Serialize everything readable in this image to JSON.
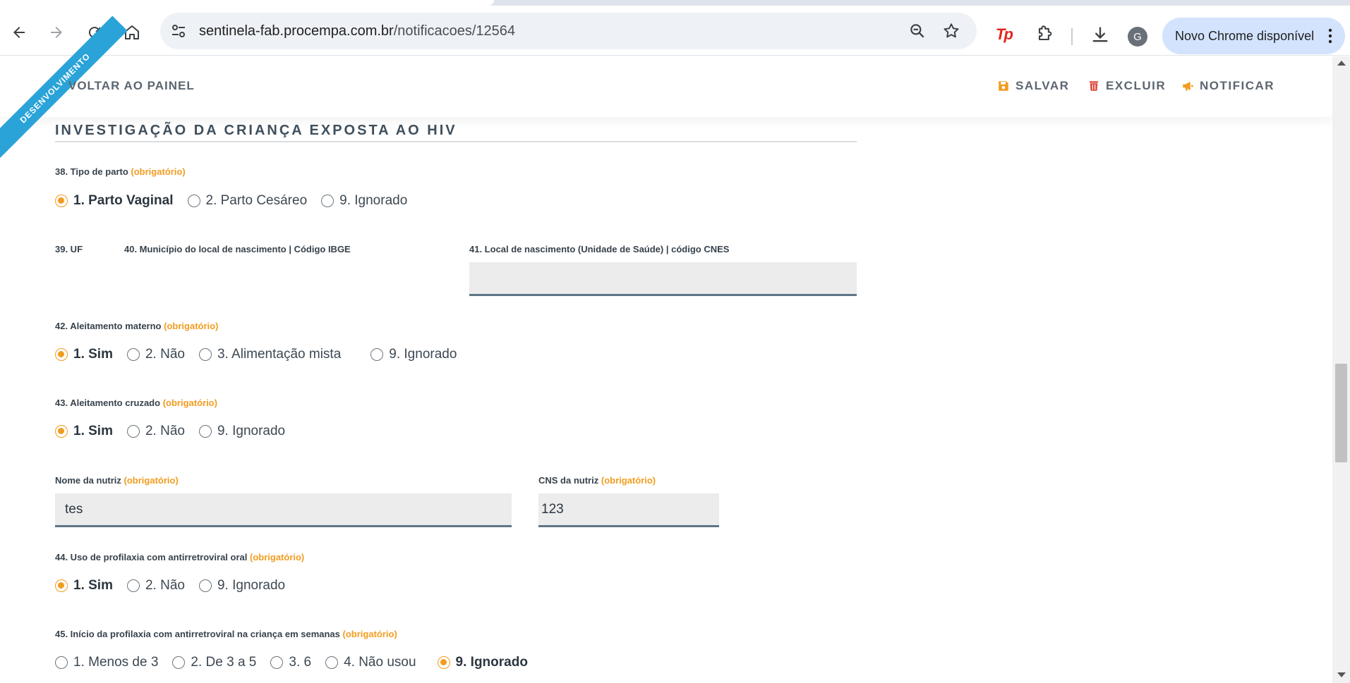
{
  "browser": {
    "url_host": "sentinela-fab.procempa.com.br",
    "url_path": "/notificacoes/12564",
    "ext_tp_label": "Tp",
    "avatar_letter": "G",
    "update_label": "Novo Chrome disponível"
  },
  "header": {
    "ribbon": "DESENVOLVIMENTO",
    "back_label": "VOLTAR AO PAINEL",
    "save_label": "SALVAR",
    "delete_label": "EXCLUIR",
    "notify_label": "NOTIFICAR"
  },
  "colors": {
    "accent": "#f29c1f",
    "delete": "#e0453a",
    "save": "#f29c1f",
    "notify": "#f29c1f",
    "ribbon": "#2aa3d8"
  },
  "form": {
    "section_title": "INVESTIGAÇÃO DA CRIANÇA EXPOSTA AO HIV",
    "required_tag": "(obrigatório)",
    "q38": {
      "label": "38. Tipo de parto",
      "options": [
        "1. Parto Vaginal",
        "2. Parto Cesáreo",
        "9. Ignorado"
      ],
      "selected": "1. Parto Vaginal"
    },
    "q39": {
      "label": "39. UF"
    },
    "q40": {
      "label": "40. Município do local de nascimento | Código IBGE"
    },
    "q41": {
      "label": "41. Local de nascimento (Unidade de Saúde) | código CNES",
      "value": ""
    },
    "q42": {
      "label": "42. Aleitamento materno",
      "options": [
        "1. Sim",
        "2. Não",
        "3. Alimentação mista",
        "9. Ignorado"
      ],
      "selected": "1. Sim"
    },
    "q43": {
      "label": "43. Aleitamento cruzado",
      "options": [
        "1. Sim",
        "2. Não",
        "9. Ignorado"
      ],
      "selected": "1. Sim"
    },
    "nutriz_name": {
      "label": "Nome da nutriz",
      "value": "tes"
    },
    "nutriz_cns": {
      "label": "CNS da nutriz",
      "value": "123"
    },
    "q44": {
      "label": "44. Uso de profilaxia com antirretroviral oral",
      "options": [
        "1. Sim",
        "2. Não",
        "9. Ignorado"
      ],
      "selected": "1. Sim"
    },
    "q45": {
      "label": "45. Início da profilaxia com antirretroviral na criança em semanas",
      "options": [
        "1. Menos de 3",
        "2. De 3 a 5",
        "3. 6",
        "4. Não usou",
        "9. Ignorado"
      ],
      "selected": "9. Ignorado"
    }
  }
}
